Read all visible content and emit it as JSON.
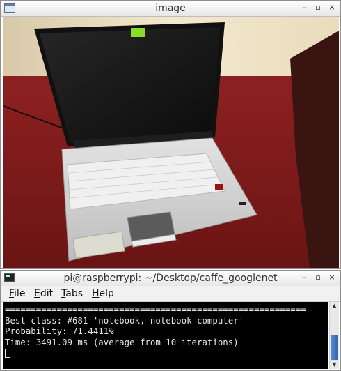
{
  "image_window": {
    "title": "image"
  },
  "terminal_window": {
    "title": "pi@raspberrypi: ~/Desktop/caffe_googlenet",
    "menu": [
      {
        "label_ul": "F",
        "label_rest": "ile"
      },
      {
        "label_ul": "E",
        "label_rest": "dit"
      },
      {
        "label_ul": "T",
        "label_rest": "abs"
      },
      {
        "label_ul": "H",
        "label_rest": "elp"
      }
    ],
    "output": {
      "separator": "==========================================================",
      "best_class": "Best class: #681 'notebook, notebook computer'",
      "probability": "Probability: 71.4411%",
      "time": "Time: 3491.09 ms (average from 10 iterations)"
    }
  },
  "window_buttons": {
    "minimize": "–",
    "maximize": "▫",
    "close": "×"
  },
  "colors": {
    "wall": "#efe3c9",
    "floor": "#7d1b1b",
    "laptop_body": "#d6d6d6",
    "screen": "#141414",
    "sticker": "#8bdc2a"
  }
}
